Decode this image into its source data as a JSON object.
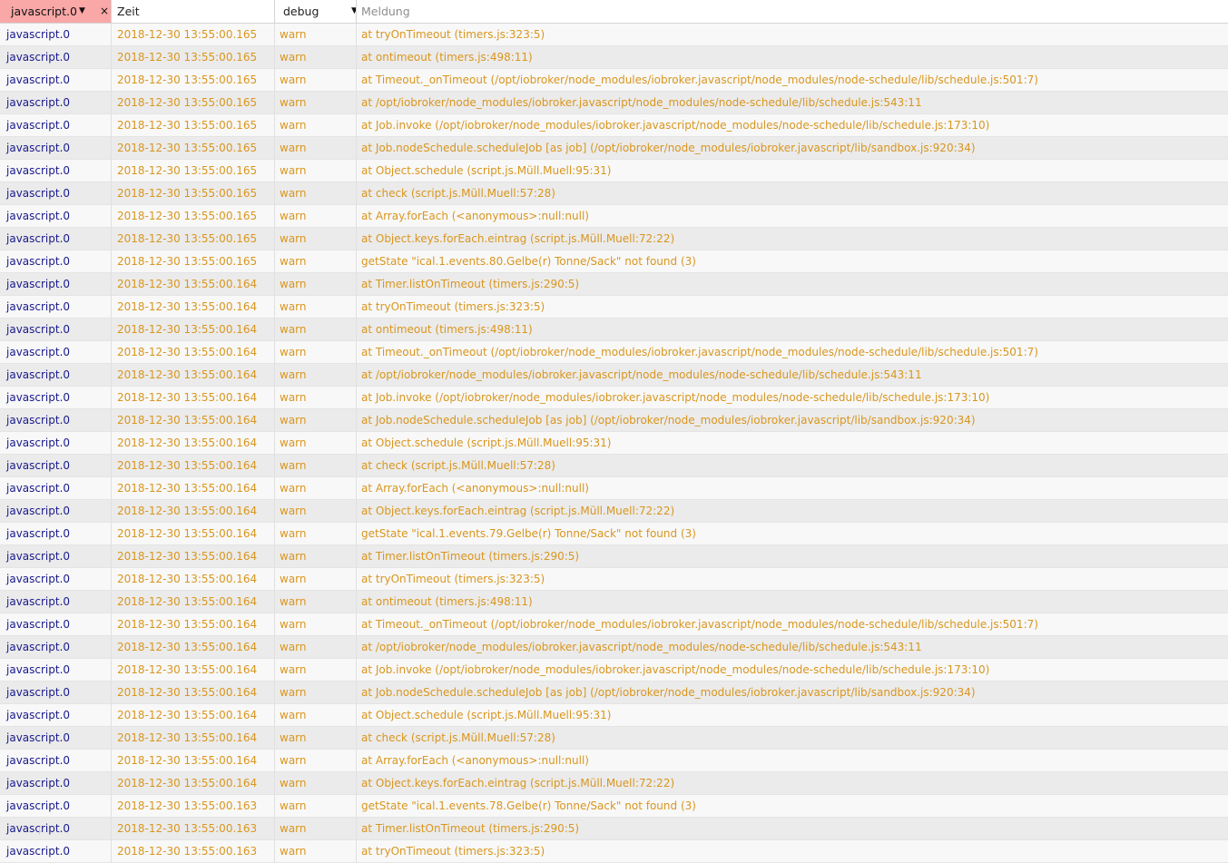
{
  "header": {
    "source_filter": "javascript.0",
    "clear_filter": "×",
    "time_label": "Zeit",
    "level_filter": "debug",
    "message_label": "Meldung",
    "dropdown_arrow": "▼"
  },
  "rows": [
    {
      "source": "javascript.0",
      "time": "2018-12-30 13:55:00.165",
      "level": "warn",
      "message": "at tryOnTimeout (timers.js:323:5)"
    },
    {
      "source": "javascript.0",
      "time": "2018-12-30 13:55:00.165",
      "level": "warn",
      "message": "at ontimeout (timers.js:498:11)"
    },
    {
      "source": "javascript.0",
      "time": "2018-12-30 13:55:00.165",
      "level": "warn",
      "message": "at Timeout._onTimeout (/opt/iobroker/node_modules/iobroker.javascript/node_modules/node-schedule/lib/schedule.js:501:7)"
    },
    {
      "source": "javascript.0",
      "time": "2018-12-30 13:55:00.165",
      "level": "warn",
      "message": "at /opt/iobroker/node_modules/iobroker.javascript/node_modules/node-schedule/lib/schedule.js:543:11"
    },
    {
      "source": "javascript.0",
      "time": "2018-12-30 13:55:00.165",
      "level": "warn",
      "message": "at Job.invoke (/opt/iobroker/node_modules/iobroker.javascript/node_modules/node-schedule/lib/schedule.js:173:10)"
    },
    {
      "source": "javascript.0",
      "time": "2018-12-30 13:55:00.165",
      "level": "warn",
      "message": "at Job.nodeSchedule.scheduleJob [as job] (/opt/iobroker/node_modules/iobroker.javascript/lib/sandbox.js:920:34)"
    },
    {
      "source": "javascript.0",
      "time": "2018-12-30 13:55:00.165",
      "level": "warn",
      "message": "at Object.schedule (script.js.Müll.Muell:95:31)"
    },
    {
      "source": "javascript.0",
      "time": "2018-12-30 13:55:00.165",
      "level": "warn",
      "message": "at check (script.js.Müll.Muell:57:28)"
    },
    {
      "source": "javascript.0",
      "time": "2018-12-30 13:55:00.165",
      "level": "warn",
      "message": "at Array.forEach (<anonymous>:null:null)"
    },
    {
      "source": "javascript.0",
      "time": "2018-12-30 13:55:00.165",
      "level": "warn",
      "message": "at Object.keys.forEach.eintrag (script.js.Müll.Muell:72:22)"
    },
    {
      "source": "javascript.0",
      "time": "2018-12-30 13:55:00.165",
      "level": "warn",
      "message": "getState \"ical.1.events.80.Gelbe(r) Tonne/Sack\" not found (3)"
    },
    {
      "source": "javascript.0",
      "time": "2018-12-30 13:55:00.164",
      "level": "warn",
      "message": "at Timer.listOnTimeout (timers.js:290:5)"
    },
    {
      "source": "javascript.0",
      "time": "2018-12-30 13:55:00.164",
      "level": "warn",
      "message": "at tryOnTimeout (timers.js:323:5)"
    },
    {
      "source": "javascript.0",
      "time": "2018-12-30 13:55:00.164",
      "level": "warn",
      "message": "at ontimeout (timers.js:498:11)"
    },
    {
      "source": "javascript.0",
      "time": "2018-12-30 13:55:00.164",
      "level": "warn",
      "message": "at Timeout._onTimeout (/opt/iobroker/node_modules/iobroker.javascript/node_modules/node-schedule/lib/schedule.js:501:7)"
    },
    {
      "source": "javascript.0",
      "time": "2018-12-30 13:55:00.164",
      "level": "warn",
      "message": "at /opt/iobroker/node_modules/iobroker.javascript/node_modules/node-schedule/lib/schedule.js:543:11"
    },
    {
      "source": "javascript.0",
      "time": "2018-12-30 13:55:00.164",
      "level": "warn",
      "message": "at Job.invoke (/opt/iobroker/node_modules/iobroker.javascript/node_modules/node-schedule/lib/schedule.js:173:10)"
    },
    {
      "source": "javascript.0",
      "time": "2018-12-30 13:55:00.164",
      "level": "warn",
      "message": "at Job.nodeSchedule.scheduleJob [as job] (/opt/iobroker/node_modules/iobroker.javascript/lib/sandbox.js:920:34)"
    },
    {
      "source": "javascript.0",
      "time": "2018-12-30 13:55:00.164",
      "level": "warn",
      "message": "at Object.schedule (script.js.Müll.Muell:95:31)"
    },
    {
      "source": "javascript.0",
      "time": "2018-12-30 13:55:00.164",
      "level": "warn",
      "message": "at check (script.js.Müll.Muell:57:28)"
    },
    {
      "source": "javascript.0",
      "time": "2018-12-30 13:55:00.164",
      "level": "warn",
      "message": "at Array.forEach (<anonymous>:null:null)"
    },
    {
      "source": "javascript.0",
      "time": "2018-12-30 13:55:00.164",
      "level": "warn",
      "message": "at Object.keys.forEach.eintrag (script.js.Müll.Muell:72:22)"
    },
    {
      "source": "javascript.0",
      "time": "2018-12-30 13:55:00.164",
      "level": "warn",
      "message": "getState \"ical.1.events.79.Gelbe(r) Tonne/Sack\" not found (3)"
    },
    {
      "source": "javascript.0",
      "time": "2018-12-30 13:55:00.164",
      "level": "warn",
      "message": "at Timer.listOnTimeout (timers.js:290:5)"
    },
    {
      "source": "javascript.0",
      "time": "2018-12-30 13:55:00.164",
      "level": "warn",
      "message": "at tryOnTimeout (timers.js:323:5)"
    },
    {
      "source": "javascript.0",
      "time": "2018-12-30 13:55:00.164",
      "level": "warn",
      "message": "at ontimeout (timers.js:498:11)"
    },
    {
      "source": "javascript.0",
      "time": "2018-12-30 13:55:00.164",
      "level": "warn",
      "message": "at Timeout._onTimeout (/opt/iobroker/node_modules/iobroker.javascript/node_modules/node-schedule/lib/schedule.js:501:7)"
    },
    {
      "source": "javascript.0",
      "time": "2018-12-30 13:55:00.164",
      "level": "warn",
      "message": "at /opt/iobroker/node_modules/iobroker.javascript/node_modules/node-schedule/lib/schedule.js:543:11"
    },
    {
      "source": "javascript.0",
      "time": "2018-12-30 13:55:00.164",
      "level": "warn",
      "message": "at Job.invoke (/opt/iobroker/node_modules/iobroker.javascript/node_modules/node-schedule/lib/schedule.js:173:10)"
    },
    {
      "source": "javascript.0",
      "time": "2018-12-30 13:55:00.164",
      "level": "warn",
      "message": "at Job.nodeSchedule.scheduleJob [as job] (/opt/iobroker/node_modules/iobroker.javascript/lib/sandbox.js:920:34)"
    },
    {
      "source": "javascript.0",
      "time": "2018-12-30 13:55:00.164",
      "level": "warn",
      "message": "at Object.schedule (script.js.Müll.Muell:95:31)"
    },
    {
      "source": "javascript.0",
      "time": "2018-12-30 13:55:00.164",
      "level": "warn",
      "message": "at check (script.js.Müll.Muell:57:28)"
    },
    {
      "source": "javascript.0",
      "time": "2018-12-30 13:55:00.164",
      "level": "warn",
      "message": "at Array.forEach (<anonymous>:null:null)"
    },
    {
      "source": "javascript.0",
      "time": "2018-12-30 13:55:00.164",
      "level": "warn",
      "message": "at Object.keys.forEach.eintrag (script.js.Müll.Muell:72:22)"
    },
    {
      "source": "javascript.0",
      "time": "2018-12-30 13:55:00.163",
      "level": "warn",
      "message": "getState \"ical.1.events.78.Gelbe(r) Tonne/Sack\" not found (3)"
    },
    {
      "source": "javascript.0",
      "time": "2018-12-30 13:55:00.163",
      "level": "warn",
      "message": "at Timer.listOnTimeout (timers.js:290:5)"
    },
    {
      "source": "javascript.0",
      "time": "2018-12-30 13:55:00.163",
      "level": "warn",
      "message": "at tryOnTimeout (timers.js:323:5)"
    }
  ]
}
